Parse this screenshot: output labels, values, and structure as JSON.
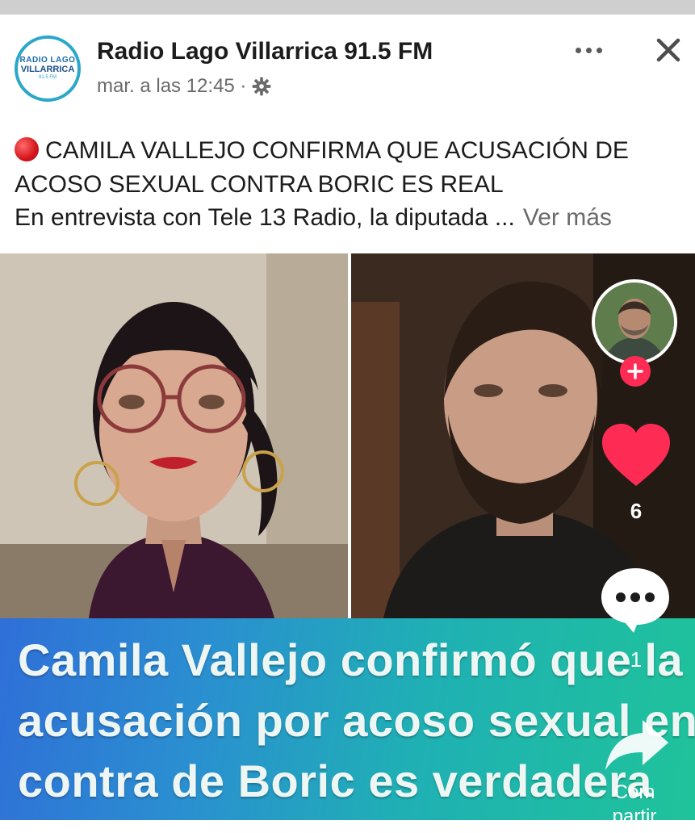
{
  "post": {
    "page_name": "Radio Lago Villarrica 91.5 FM",
    "timestamp": "mar. a las 12:45 ·",
    "audience_icon": "gear-icon",
    "avatar_logo": {
      "line1": "RADIO LAGO",
      "line2": "VILLARRICA",
      "line3": "91.5 FM"
    },
    "headline": "CAMILA VALLEJO CONFIRMA QUE ACUSACIÓN DE ACOSO SEXUAL CONTRA BORIC ES REAL",
    "excerpt": "En entrevista con Tele 13 Radio, la diputada ...",
    "see_more": "Ver más"
  },
  "video": {
    "banner_lines": [
      "Camila Vallejo confirmó que la",
      "acusación por acoso sexual en",
      "contra de Boric es verdadera"
    ],
    "sidebar": {
      "like_count": "6",
      "comment_count": "1",
      "share_label": "Compartir"
    }
  },
  "colors": {
    "banner_start": "#2f6fd8",
    "banner_end": "#1fc39a",
    "like_red": "#fe2c55",
    "headline_dot": "#d4141c"
  }
}
